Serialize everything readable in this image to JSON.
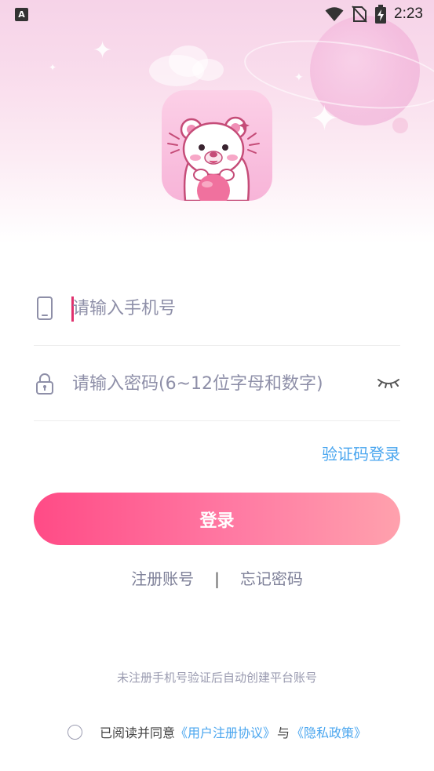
{
  "status_bar": {
    "time": "2:23",
    "left_icon": "A",
    "icons": [
      "wifi-icon",
      "no-sim-icon",
      "battery-charging-icon"
    ]
  },
  "app": {
    "logo_icon": "bear-mascot-logo"
  },
  "form": {
    "phone_placeholder": "请输入手机号",
    "password_placeholder": "请输入密码(6~12位字母和数字)",
    "code_login_label": "验证码登录",
    "login_button_label": "登录"
  },
  "links": {
    "register_label": "注册账号",
    "separator": "|",
    "forgot_label": "忘记密码"
  },
  "notice": "未注册手机号验证后自动创建平台账号",
  "agreement": {
    "prefix": "已阅读并同意",
    "user_agreement": "《用户注册协议》",
    "conjunction": "与",
    "privacy_policy": "《隐私政策》",
    "checked": false
  },
  "colors": {
    "accent_pink": "#ff4b86",
    "link_blue": "#4aa6ef",
    "placeholder_gray": "#8e8fa8"
  }
}
